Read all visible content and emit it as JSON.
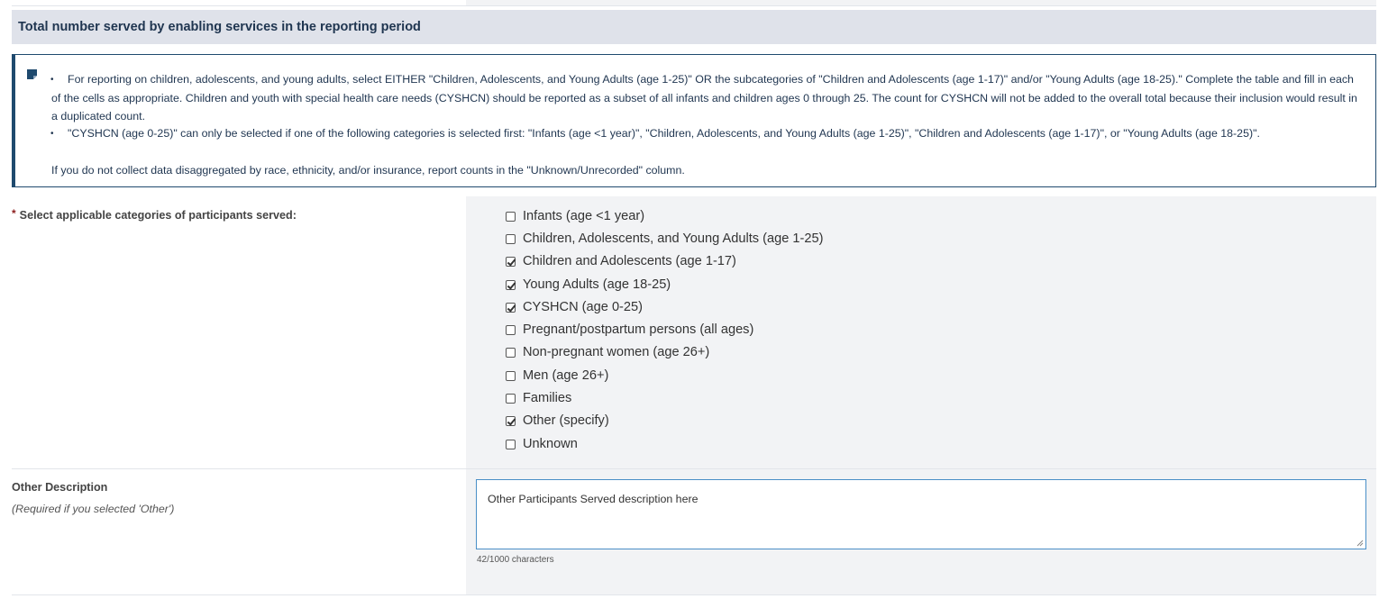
{
  "section": {
    "title": "Total number served by enabling services in the reporting period"
  },
  "info": {
    "bullets": [
      "For reporting on children, adolescents, and young adults, select EITHER \"Children, Adolescents, and Young Adults (age 1-25)\" OR the subcategories of \"Children and Adolescents (age 1-17)\" and/or \"Young Adults (age 18-25).\" Complete the table and fill in each of the cells as appropriate. Children and youth with special health care needs (CYSHCN) should be reported as a subset of all infants and children ages 0 through 25. The count for CYSHCN will not be added to the overall total because their inclusion would result in a duplicated count.",
      "\"CYSHCN (age 0-25)\" can only be selected if one of the following categories is selected first: \"Infants (age <1 year)\", \"Children, Adolescents, and Young Adults (age 1-25)\", \"Children and Adolescents (age 1-17)\", or \"Young Adults (age 18-25)\"."
    ],
    "footer": "If you do not collect data disaggregated by race, ethnicity, and/or insurance, report counts in the \"Unknown/Unrecorded\" column.",
    "icon": "note-icon"
  },
  "categories": {
    "label": "Select applicable categories of participants served:",
    "required_mark": "*",
    "options": [
      {
        "label": "Infants (age <1 year)",
        "checked": false
      },
      {
        "label": "Children, Adolescents, and Young Adults (age 1-25)",
        "checked": false
      },
      {
        "label": "Children and Adolescents (age 1-17)",
        "checked": true
      },
      {
        "label": "Young Adults (age 18-25)",
        "checked": true
      },
      {
        "label": "CYSHCN (age 0-25)",
        "checked": true
      },
      {
        "label": "Pregnant/postpartum persons (all ages)",
        "checked": false
      },
      {
        "label": "Non-pregnant women (age 26+)",
        "checked": false
      },
      {
        "label": "Men (age 26+)",
        "checked": false
      },
      {
        "label": "Families",
        "checked": false
      },
      {
        "label": "Other (specify)",
        "checked": true
      },
      {
        "label": "Unknown",
        "checked": false
      }
    ]
  },
  "other": {
    "label": "Other Description",
    "hint": "(Required if you selected 'Other')",
    "value": "Other Participants Served description here",
    "char_count": "42/1000 characters"
  },
  "colors": {
    "header_bg": "#dfe2ea",
    "accent": "#1f4a6e",
    "required": "#8b1c1c",
    "focus_border": "#4a8fc7"
  }
}
